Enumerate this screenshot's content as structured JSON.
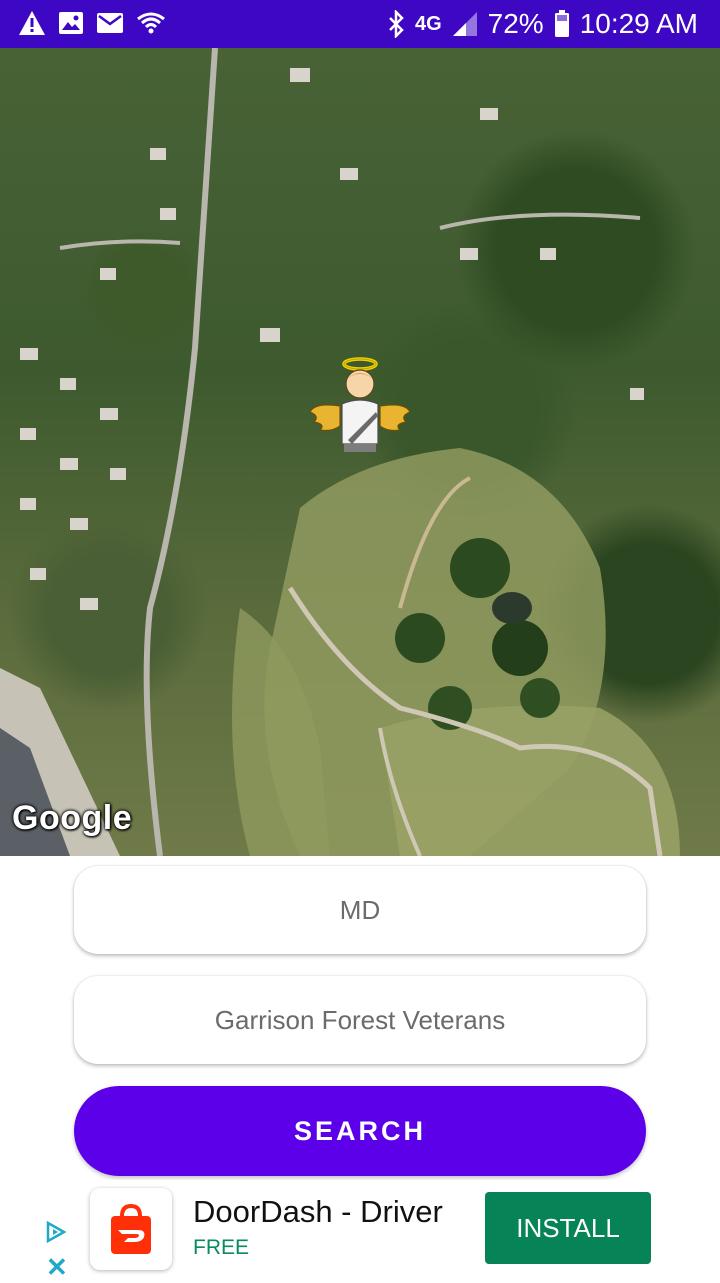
{
  "status_bar": {
    "battery": "72%",
    "time": "10:29 AM",
    "network": "4G",
    "icons": [
      "alert-icon",
      "image-icon",
      "mail-icon",
      "wifi-icon",
      "bluetooth-icon",
      "signal-icon",
      "battery-icon"
    ]
  },
  "map": {
    "attribution": "Google",
    "marker_icon": "angel-marker-icon"
  },
  "form": {
    "state_value": "MD",
    "cemetery_value": "Garrison Forest Veterans",
    "search_label": "SEARCH"
  },
  "ad": {
    "app_name": "DoorDash - Driver",
    "price": "FREE",
    "install_label": "INSTALL",
    "close_glyph": "✕"
  },
  "colors": {
    "status_bar": "#3d07c3",
    "primary": "#5b00e8",
    "install": "#068457"
  }
}
